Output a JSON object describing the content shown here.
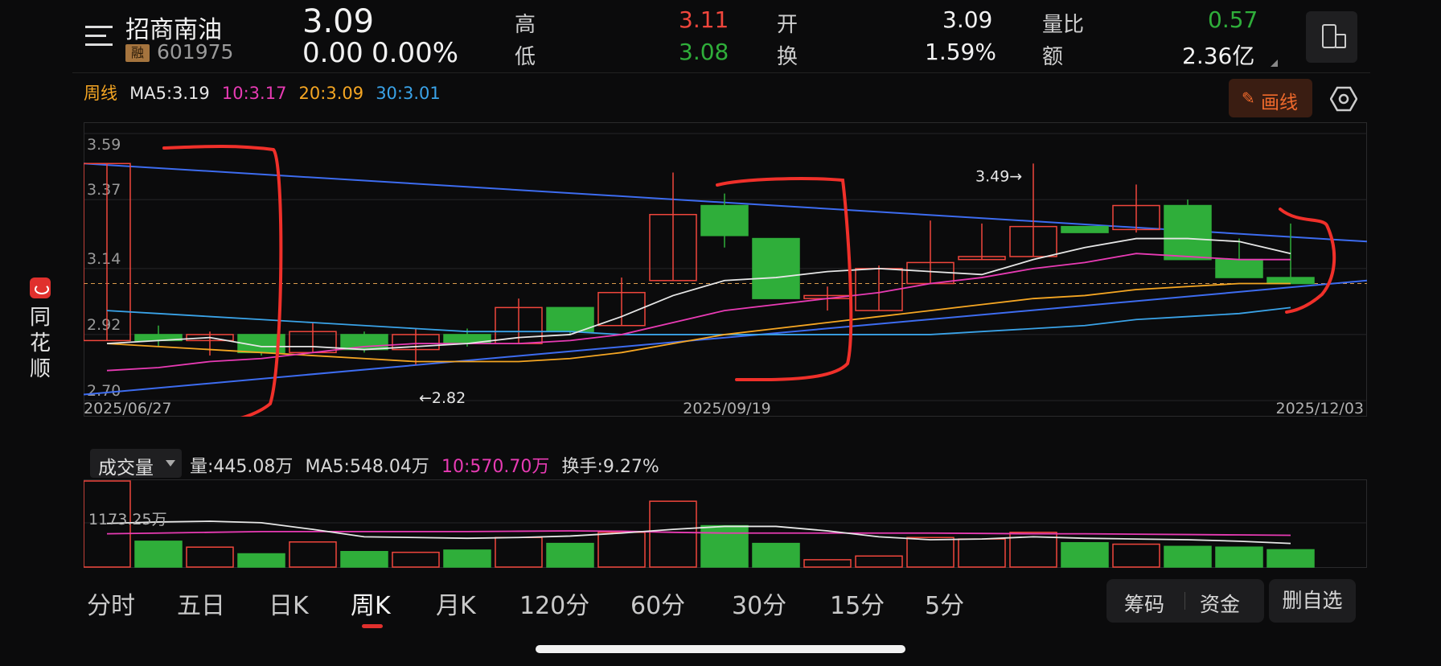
{
  "header": {
    "menu_icon": "menu-lines-icon",
    "stock_name": "招商南油",
    "margin_badge": "融",
    "stock_code": "601975",
    "price": "3.09",
    "change": "0.00",
    "change_pct": "0.00%",
    "stats": {
      "high_label": "高",
      "high_value": "3.11",
      "low_label": "低",
      "low_value": "3.08",
      "open_label": "开",
      "open_value": "3.09",
      "turnover_label": "换",
      "turnover_value": "1.59%",
      "vol_ratio_label": "量比",
      "vol_ratio_value": "0.57",
      "amount_label": "额",
      "amount_value": "2.36亿"
    },
    "device_icon": "landscape-switch-icon"
  },
  "sidebar": {
    "app_chars": [
      "同",
      "花",
      "顺"
    ],
    "logo_icon": "tonghuashun-logo-icon"
  },
  "ma_legend": {
    "period": "周线",
    "ma5": "MA5:3.19",
    "ma10": "10:3.17",
    "ma20": "20:3.09",
    "ma30": "30:3.01"
  },
  "draw_button": {
    "label": "画线",
    "icon": "pencil-icon"
  },
  "settings_icon": "hexagon-settings-icon",
  "colors": {
    "up": "#f0463c",
    "down": "#2fae3a",
    "ma5": "#e6e6e6",
    "ma10": "#e83bb4",
    "ma20": "#f5a623",
    "ma30": "#3aa3e8",
    "trend": "#3d6cf0",
    "annot": "#f0302a"
  },
  "price_chart": {
    "y_ticks": [
      "3.59",
      "3.37",
      "3.14",
      "2.92",
      "2.70"
    ],
    "x_labels": [
      "2025/06/27",
      "2025/09/19",
      "2025/12/03"
    ],
    "high_marker": "3.49→",
    "low_marker": "←2.82",
    "current_price_line": 3.09
  },
  "volume_panel": {
    "indicator_select": "成交量",
    "volume": "量:445.08万",
    "ma5": "MA5:548.04万",
    "ma10": "10:570.70万",
    "turnover": "换手:9.27%",
    "max_tick": "1173.25万"
  },
  "chart_data": {
    "type": "candlestick",
    "period": "weekly",
    "y_range": [
      2.7,
      3.59
    ],
    "candles": [
      {
        "o": 2.9,
        "c": 3.49,
        "h": 3.49,
        "l": 2.9
      },
      {
        "o": 2.92,
        "c": 2.9,
        "h": 2.95,
        "l": 2.88
      },
      {
        "o": 2.9,
        "c": 2.92,
        "h": 2.93,
        "l": 2.85
      },
      {
        "o": 2.92,
        "c": 2.86,
        "h": 2.92,
        "l": 2.85
      },
      {
        "o": 2.86,
        "c": 2.93,
        "h": 2.96,
        "l": 2.86
      },
      {
        "o": 2.92,
        "c": 2.87,
        "h": 2.93,
        "l": 2.86
      },
      {
        "o": 2.87,
        "c": 2.92,
        "h": 2.94,
        "l": 2.82
      },
      {
        "o": 2.92,
        "c": 2.89,
        "h": 2.94,
        "l": 2.88
      },
      {
        "o": 2.89,
        "c": 3.01,
        "h": 3.04,
        "l": 2.89
      },
      {
        "o": 3.01,
        "c": 2.93,
        "h": 3.01,
        "l": 2.92
      },
      {
        "o": 2.95,
        "c": 3.06,
        "h": 3.11,
        "l": 2.95
      },
      {
        "o": 3.1,
        "c": 3.32,
        "h": 3.46,
        "l": 3.1
      },
      {
        "o": 3.35,
        "c": 3.25,
        "h": 3.39,
        "l": 3.21
      },
      {
        "o": 3.24,
        "c": 3.04,
        "h": 3.24,
        "l": 3.04
      },
      {
        "o": 3.04,
        "c": 3.05,
        "h": 3.08,
        "l": 3.0
      },
      {
        "o": 3.0,
        "c": 3.14,
        "h": 3.15,
        "l": 3.0
      },
      {
        "o": 3.09,
        "c": 3.16,
        "h": 3.3,
        "l": 3.09
      },
      {
        "o": 3.17,
        "c": 3.18,
        "h": 3.29,
        "l": 3.17
      },
      {
        "o": 3.18,
        "c": 3.28,
        "h": 3.49,
        "l": 3.18
      },
      {
        "o": 3.28,
        "c": 3.26,
        "h": 3.28,
        "l": 3.26
      },
      {
        "o": 3.27,
        "c": 3.35,
        "h": 3.42,
        "l": 3.26
      },
      {
        "o": 3.35,
        "c": 3.17,
        "h": 3.37,
        "l": 3.17
      },
      {
        "o": 3.17,
        "c": 3.11,
        "h": 3.24,
        "l": 3.11
      },
      {
        "o": 3.11,
        "c": 3.09,
        "h": 3.29,
        "l": 3.09
      }
    ],
    "ma5": [
      2.89,
      2.9,
      2.91,
      2.88,
      2.88,
      2.87,
      2.88,
      2.89,
      2.91,
      2.92,
      2.98,
      3.05,
      3.1,
      3.11,
      3.13,
      3.14,
      3.13,
      3.12,
      3.17,
      3.21,
      3.24,
      3.24,
      3.23,
      3.19
    ],
    "ma10": [
      2.8,
      2.81,
      2.83,
      2.84,
      2.86,
      2.88,
      2.89,
      2.89,
      2.89,
      2.9,
      2.92,
      2.96,
      3.0,
      3.02,
      3.04,
      3.06,
      3.09,
      3.11,
      3.14,
      3.16,
      3.19,
      3.18,
      3.17,
      3.17
    ],
    "ma20": [
      2.89,
      2.88,
      2.87,
      2.86,
      2.85,
      2.84,
      2.83,
      2.83,
      2.83,
      2.84,
      2.86,
      2.89,
      2.92,
      2.94,
      2.96,
      2.98,
      3.0,
      3.02,
      3.04,
      3.05,
      3.07,
      3.08,
      3.09,
      3.09
    ],
    "ma30": [
      3.0,
      2.99,
      2.98,
      2.97,
      2.96,
      2.95,
      2.94,
      2.93,
      2.93,
      2.93,
      2.92,
      2.92,
      2.92,
      2.92,
      2.92,
      2.92,
      2.92,
      2.93,
      2.94,
      2.95,
      2.97,
      2.98,
      2.99,
      3.01
    ],
    "volume_range": [
      0,
      1173.25
    ],
    "volumes": [
      1173.25,
      360,
      280,
      190,
      350,
      220,
      210,
      240,
      410,
      330,
      480,
      900,
      570,
      330,
      110,
      160,
      410,
      390,
      480,
      340,
      320,
      290,
      280,
      245
    ],
    "vol_ma5": [
      600,
      620,
      630,
      610,
      520,
      420,
      410,
      400,
      410,
      430,
      470,
      520,
      560,
      560,
      500,
      420,
      380,
      390,
      420,
      400,
      390,
      380,
      360,
      330
    ],
    "vol_ma10": [
      460,
      470,
      480,
      490,
      490,
      490,
      490,
      490,
      495,
      500,
      495,
      480,
      470,
      470,
      470,
      470,
      470,
      465,
      460,
      460,
      455,
      450,
      445,
      440
    ]
  },
  "period_tabs": [
    "分时",
    "五日",
    "日K",
    "周K",
    "月K",
    "120分",
    "60分",
    "30分",
    "15分",
    "5分"
  ],
  "active_tab": "周K",
  "bottom_buttons": {
    "chips": "筹码",
    "funds": "资金",
    "delete": "删自选"
  }
}
